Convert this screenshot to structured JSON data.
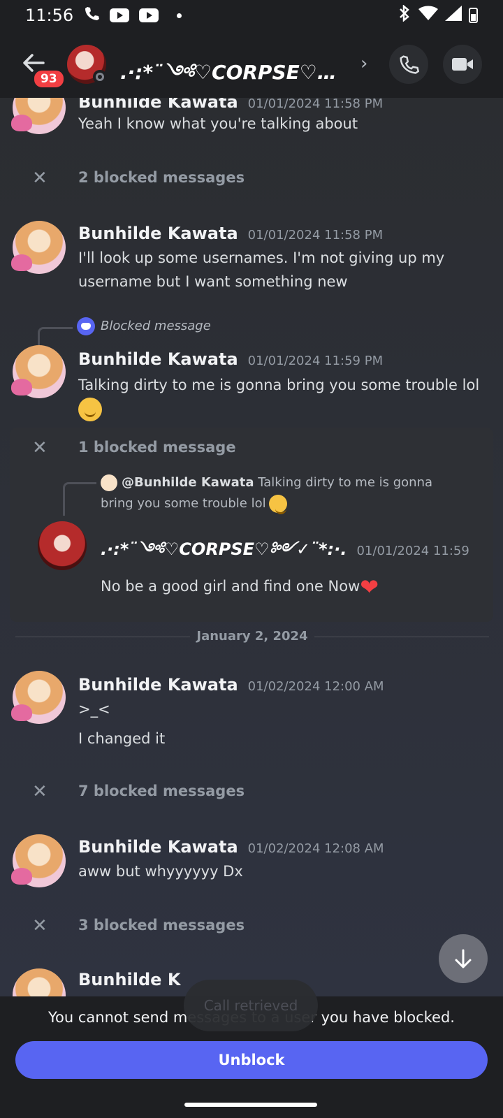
{
  "status_bar": {
    "time": "11:56"
  },
  "header": {
    "unread_badge": "93",
    "title": ".·:*¨༺♡CORPSE♡…",
    "chevron": "›"
  },
  "messages": [
    {
      "name": "Bunhilde Kawata",
      "timestamp": "01/01/2024 11:58 PM",
      "text": "Yeah I know what you're talking about"
    },
    {
      "blocked": "2 blocked messages"
    },
    {
      "name": "Bunhilde Kawata",
      "timestamp": "01/01/2024 11:58 PM",
      "text": "I'll look up some usernames. I'm not giving up my username but I want something new"
    },
    {
      "reply_label": "Blocked message",
      "name": "Bunhilde Kawata",
      "timestamp": "01/01/2024 11:59 PM",
      "text": "Talking dirty to me is gonna bring you some trouble lol"
    }
  ],
  "expanded_block": {
    "label": "1 blocked message",
    "reply_author": "@Bunhilde Kawata",
    "reply_text": "Talking dirty to me is gonna bring you some trouble lol",
    "name": ".·:*¨༺♡CORPSE♡༻✓¨*:·.",
    "timestamp": "01/01/2024 11:59",
    "text": "No be a good girl and find one  Now"
  },
  "date_divider": "January 2, 2024",
  "messages2": [
    {
      "name": "Bunhilde Kawata",
      "timestamp": "01/02/2024 12:00 AM",
      "line1": ">_<",
      "line2": "I changed it"
    },
    {
      "blocked": "7 blocked messages"
    },
    {
      "name": "Bunhilde Kawata",
      "timestamp": "01/02/2024 12:08 AM",
      "text": "aww but whyyyyyy Dx"
    },
    {
      "blocked": "3 blocked messages"
    }
  ],
  "partial_name": "Bunhilde K",
  "toast": "Call retrieved",
  "footer": {
    "notice": "You cannot send messages to a user you have blocked.",
    "unblock_label": "Unblock"
  }
}
